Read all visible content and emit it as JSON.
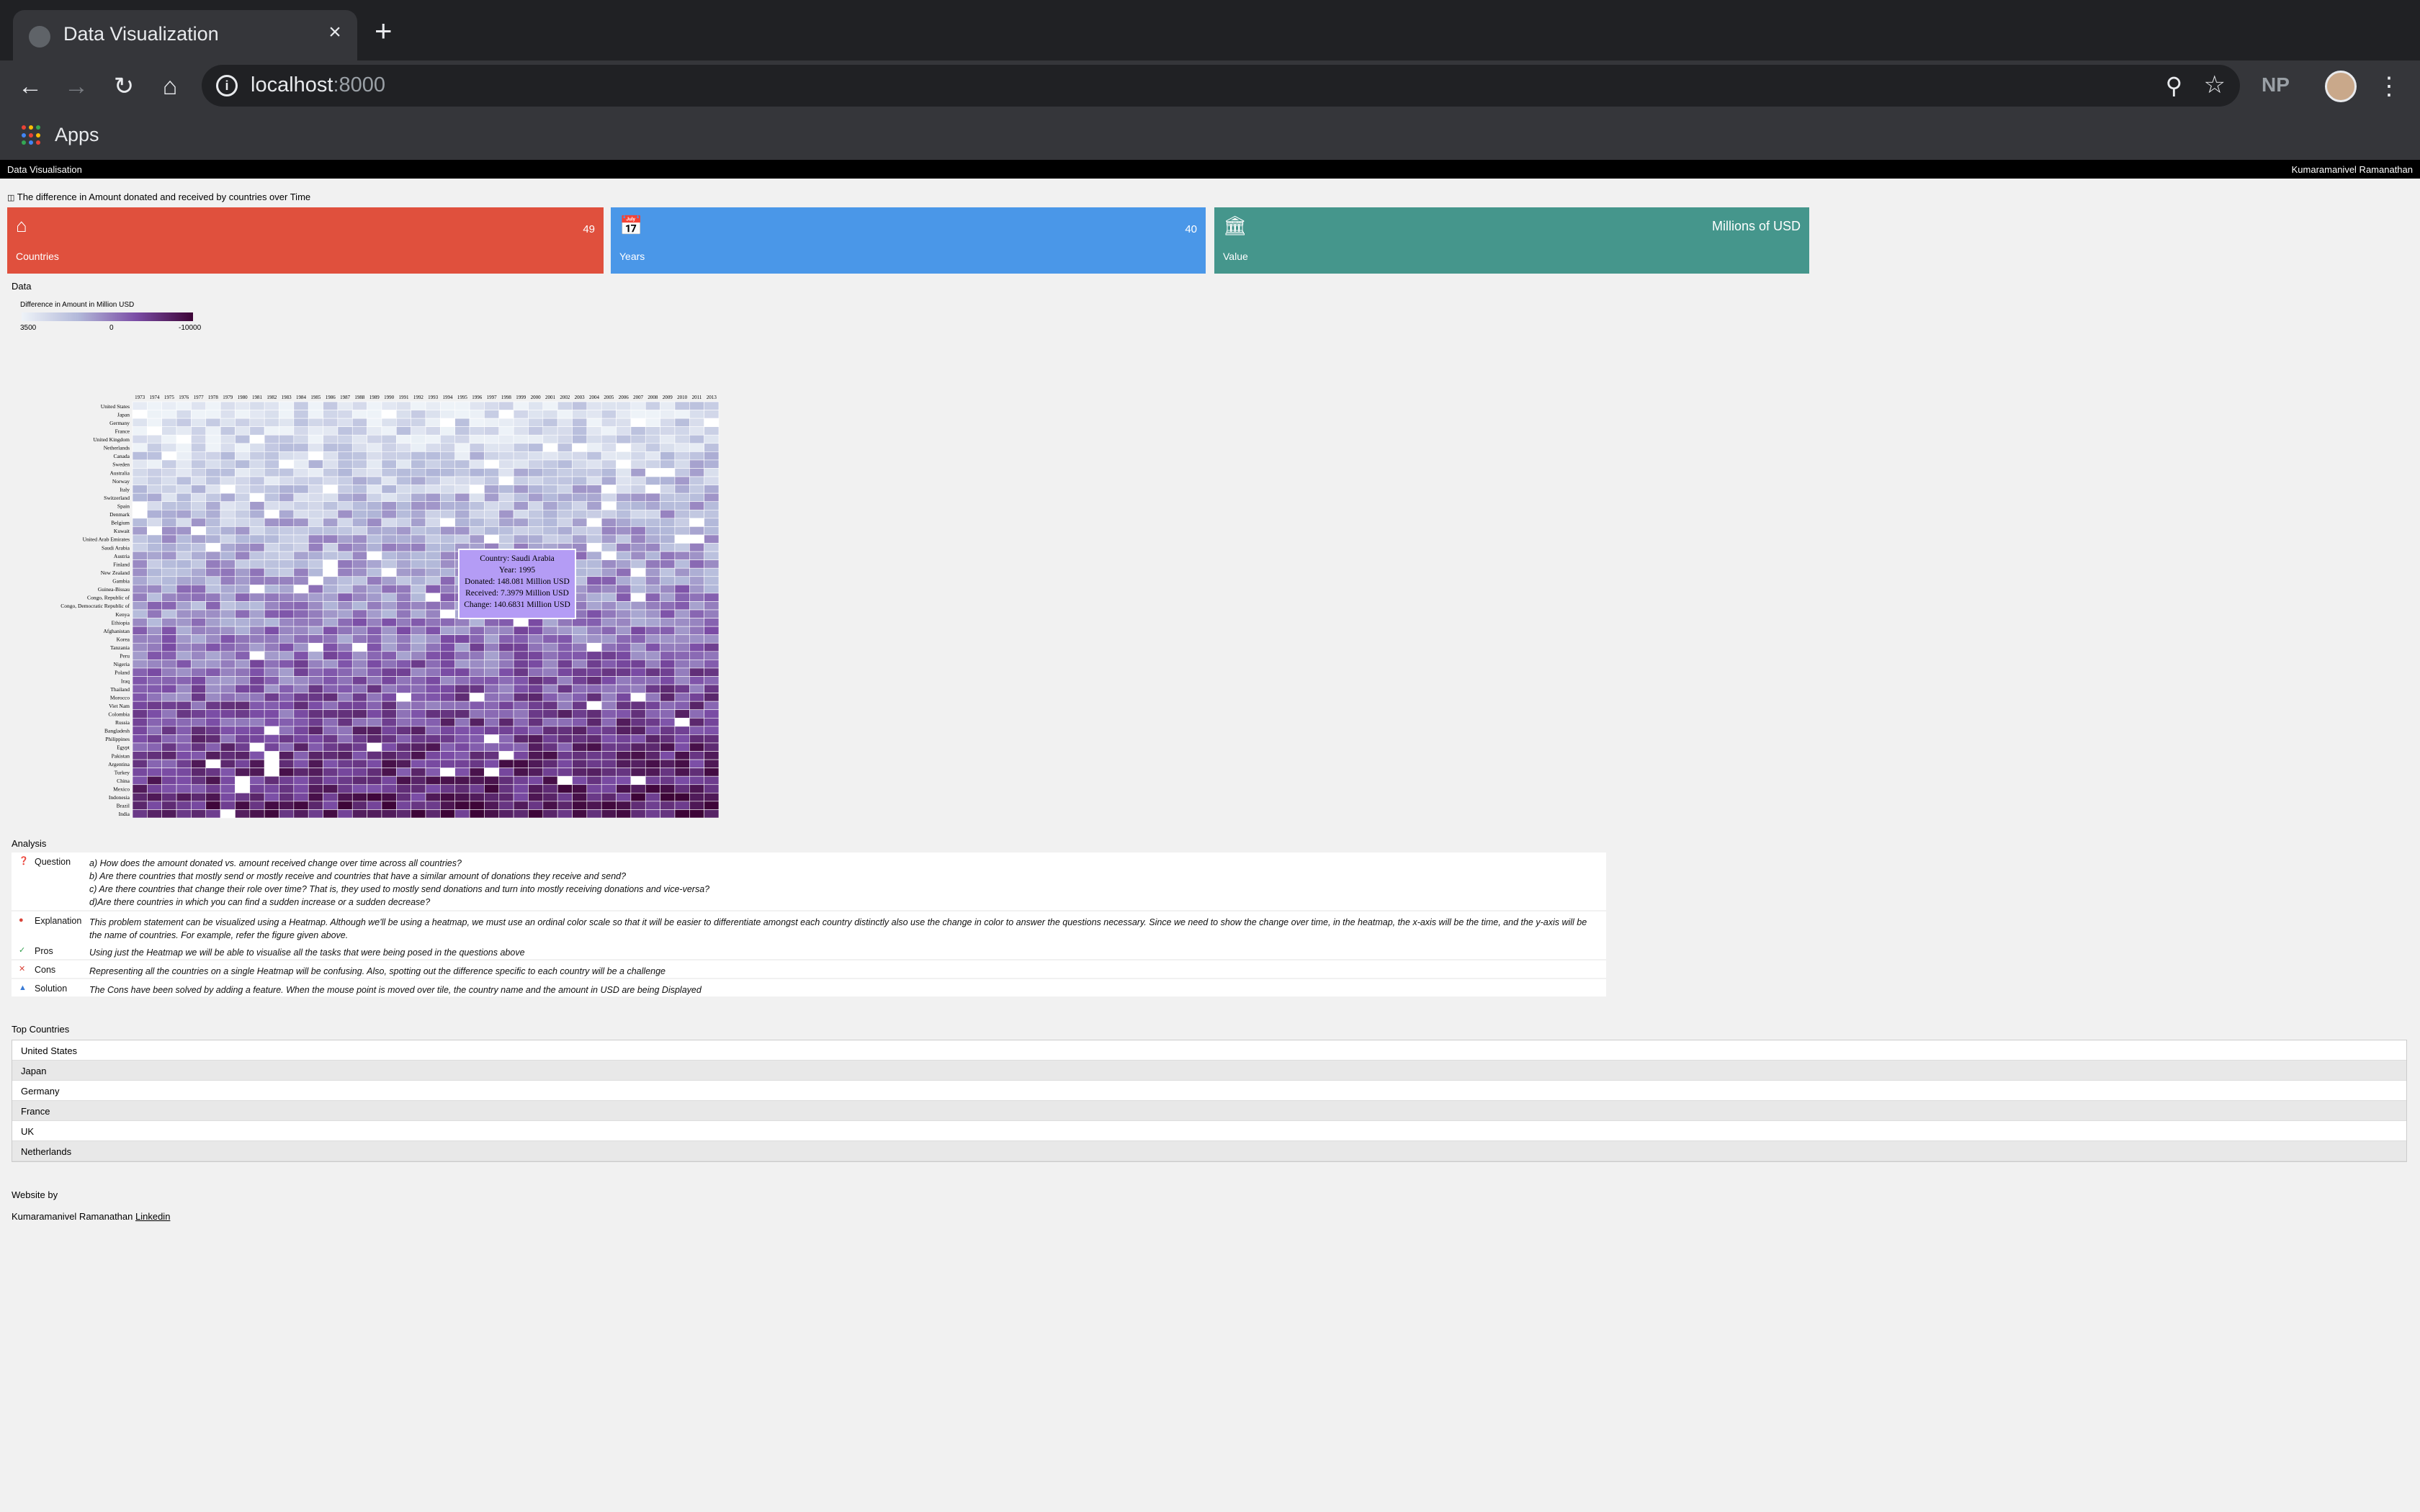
{
  "browser": {
    "tab_title": "Data Visualization",
    "tab_close": "×",
    "new_tab": "+",
    "url_host": "localhost",
    "url_port": ":8000",
    "profile_initials": "NP",
    "bookmarks_label": "Apps"
  },
  "page": {
    "topbar_left": "Data Visualisation",
    "topbar_right": "Kumaramanivel Ramanathan",
    "subtitle": "The difference in Amount donated and received by countries over Time",
    "cards": [
      {
        "label": "Countries",
        "value": "49",
        "icon": "home-icon",
        "color": "#e0503d"
      },
      {
        "label": "Years",
        "value": "40",
        "icon": "calendar-icon",
        "color": "#4a97e8"
      },
      {
        "label": "Value",
        "value": "Millions of USD",
        "icon": "bank-icon",
        "color": "#45968c"
      }
    ],
    "data_title": "Data",
    "legend": {
      "title": "Difference in Amount in Million USD",
      "ticks": [
        "3500",
        "0",
        "-10000"
      ]
    },
    "tooltip": {
      "country": "Country: Saudi Arabia",
      "year": "Year: 1995",
      "donated": "Donated: 148.081 Million USD",
      "received": "Received: 7.3979 Million USD",
      "change": "Change: 140.6831 Million USD"
    },
    "analysis_title": "Analysis",
    "analysis": [
      {
        "key": "Question",
        "icon": "question-icon",
        "color": "#3a7bd5",
        "lines": [
          "a) How does the amount donated vs. amount received change over time across all countries?",
          "b) Are there countries that mostly send or mostly receive and countries that have a similar amount of donations they receive and send?",
          "c) Are there countries that change their role over time? That is, they used to mostly send donations and turn into mostly receiving donations and vice-versa?",
          "d)Are there countries in which you can find a sudden increase or a sudden decrease?"
        ]
      },
      {
        "key": "Explanation",
        "icon": "comment-icon",
        "color": "#d9443a",
        "lines": [
          "This problem statement can be visualized using a Heatmap. Although we'll be using a heatmap, we must use an ordinal color scale so that it will be easier to differentiate amongst each country distinctly also use the change in color to answer the questions necessary. Since we need to show the change over time, in the heatmap, the x-axis will be the time, and the y-axis will be the name of countries. For example, refer the figure given above."
        ]
      },
      {
        "key": "Pros",
        "icon": "check-icon",
        "color": "#2e9e4a",
        "lines": [
          "Using just the Heatmap we will be able to visualise all the tasks that were being posed in the questions above"
        ]
      },
      {
        "key": "Cons",
        "icon": "cross-icon",
        "color": "#d9443a",
        "lines": [
          "Representing all the countries on a single Heatmap will be confusing. Also, spotting out the difference specific to each country will be a challenge"
        ]
      },
      {
        "key": "Solution",
        "icon": "thumbs-up-icon",
        "color": "#3a7bd5",
        "lines": [
          "The Cons have been solved by adding a feature. When the mouse point is moved over tile, the country name and the amount in USD are being Displayed"
        ]
      }
    ],
    "top_countries_title": "Top Countries",
    "top_countries": [
      "United States",
      "Japan",
      "Germany",
      "France",
      "UK",
      "Netherlands"
    ],
    "footer_title": "Website by",
    "footer_name": "Kumaramanivel Ramanathan",
    "footer_link": "Linkedin"
  },
  "chart_data": {
    "type": "heatmap",
    "title": "",
    "xlabel": "",
    "ylabel": "",
    "x": [
      "1973",
      "1974",
      "1975",
      "1976",
      "1977",
      "1978",
      "1979",
      "1980",
      "1981",
      "1982",
      "1983",
      "1984",
      "1985",
      "1986",
      "1987",
      "1988",
      "1989",
      "1990",
      "1991",
      "1992",
      "1993",
      "1994",
      "1995",
      "1996",
      "1997",
      "1998",
      "1999",
      "2000",
      "2001",
      "2002",
      "2003",
      "2004",
      "2005",
      "2006",
      "2007",
      "2008",
      "2009",
      "2010",
      "2011",
      "2013"
    ],
    "y": [
      "United States",
      "Japan",
      "Germany",
      "France",
      "United Kingdom",
      "Netherlands",
      "Canada",
      "Sweden",
      "Australia",
      "Norway",
      "Italy",
      "Switzerland",
      "Spain",
      "Denmark",
      "Belgium",
      "Kuwait",
      "United Arab Emirates",
      "Saudi Arabia",
      "Austria",
      "Finland",
      "New Zealand",
      "Gambia",
      "Guinea-Bissau",
      "Congo, Republic of",
      "Congo, Democratic Republic of",
      "Kenya",
      "Ethiopia",
      "Afghanistan",
      "Korea",
      "Tanzania",
      "Peru",
      "Nigeria",
      "Poland",
      "Iraq",
      "Thailand",
      "Morocco",
      "Viet Nam",
      "Colombia",
      "Russia",
      "Bangladesh",
      "Philippines",
      "Egypt",
      "Pakistan",
      "Argentina",
      "Turkey",
      "China",
      "Mexico",
      "Indonesia",
      "Brazil",
      "India"
    ],
    "color_scale": {
      "min": -10000,
      "mid": 0,
      "max": 3500,
      "colors": [
        "#eef3f8",
        "#b2b8d9",
        "#7b4da6",
        "#3d0437"
      ]
    },
    "highlight": {
      "country": "Saudi Arabia",
      "year": "1995",
      "donated": 148.081,
      "received": 7.3979,
      "change": 140.6831
    }
  }
}
